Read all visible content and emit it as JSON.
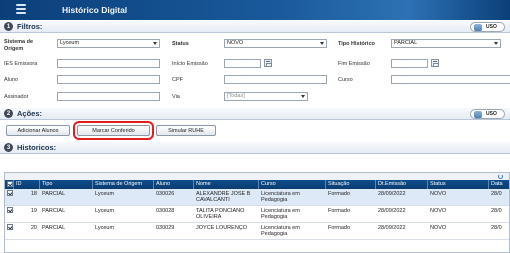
{
  "app": {
    "title": "Histórico Digital"
  },
  "filtros": {
    "title": "Filtros:",
    "number": "1",
    "uso_label": "USO",
    "sistema_origem_label": "Sistema de Origem",
    "sistema_origem_value": "Lyceum",
    "status_label": "Status",
    "status_value": "NOVO",
    "tipo_historico_label": "Tipo Histórico",
    "tipo_historico_value": "PARCIAL",
    "ies_emissora_label": "IES Emissora",
    "ies_emissora_value": "",
    "inicio_emissao_label": "Início Emissão",
    "inicio_emissao_value": "",
    "fim_emissao_label": "Fim Emissão",
    "fim_emissao_value": "",
    "aluno_label": "Aluno",
    "aluno_value": "",
    "cpf_label": "CPF",
    "cpf_value": "",
    "curso_label": "Curso",
    "curso_value": "",
    "assinador_label": "Assinador",
    "assinador_value": "",
    "via_label": "Via",
    "via_value": "[Todas]"
  },
  "acoes": {
    "title": "Ações:",
    "number": "2",
    "uso_label": "USO",
    "adicionar_alunos": "Adicionar Alunos",
    "marcar_conferido": "Marcar Conferido",
    "simular_ruhe": "Simular RUHE"
  },
  "historicos": {
    "title": "Historicos:",
    "number": "3",
    "columns": [
      "ID",
      "Tipo",
      "Sistema de Origem",
      "Aluno",
      "Nome",
      "Curso",
      "Situação",
      "Dt.Emissão",
      "Status",
      "Data"
    ],
    "rows": [
      {
        "id": "18",
        "tipo": "PARCIAL",
        "sistema": "Lyceum",
        "aluno": "030026",
        "nome": "ALEXANDRE JOSE B CAVALCANTI",
        "curso": "Licenciatura em Pedagogia",
        "situacao": "Formado",
        "dt_emissao": "28/09/2022",
        "status": "NOVO",
        "data": "28/0"
      },
      {
        "id": "19",
        "tipo": "PARCIAL",
        "sistema": "Lyceum",
        "aluno": "030028",
        "nome": "TALITA PONCIANO OLIVEIRA",
        "curso": "Licenciatura em Pedagogia",
        "situacao": "Formado",
        "dt_emissao": "28/09/2022",
        "status": "NOVO",
        "data": "28/0"
      },
      {
        "id": "20",
        "tipo": "PARCIAL",
        "sistema": "Lyceum",
        "aluno": "030029",
        "nome": "JOYCE LOURENÇO",
        "curso": "Licenciatura em Pedagogia",
        "situacao": "Formado",
        "dt_emissao": "28/09/2022",
        "status": "NOVO",
        "data": "28/0"
      }
    ]
  },
  "colors": {
    "header_blue": "#0b3f7a",
    "grid_header": "#0e4d8c",
    "highlight_red": "#e0201e"
  }
}
